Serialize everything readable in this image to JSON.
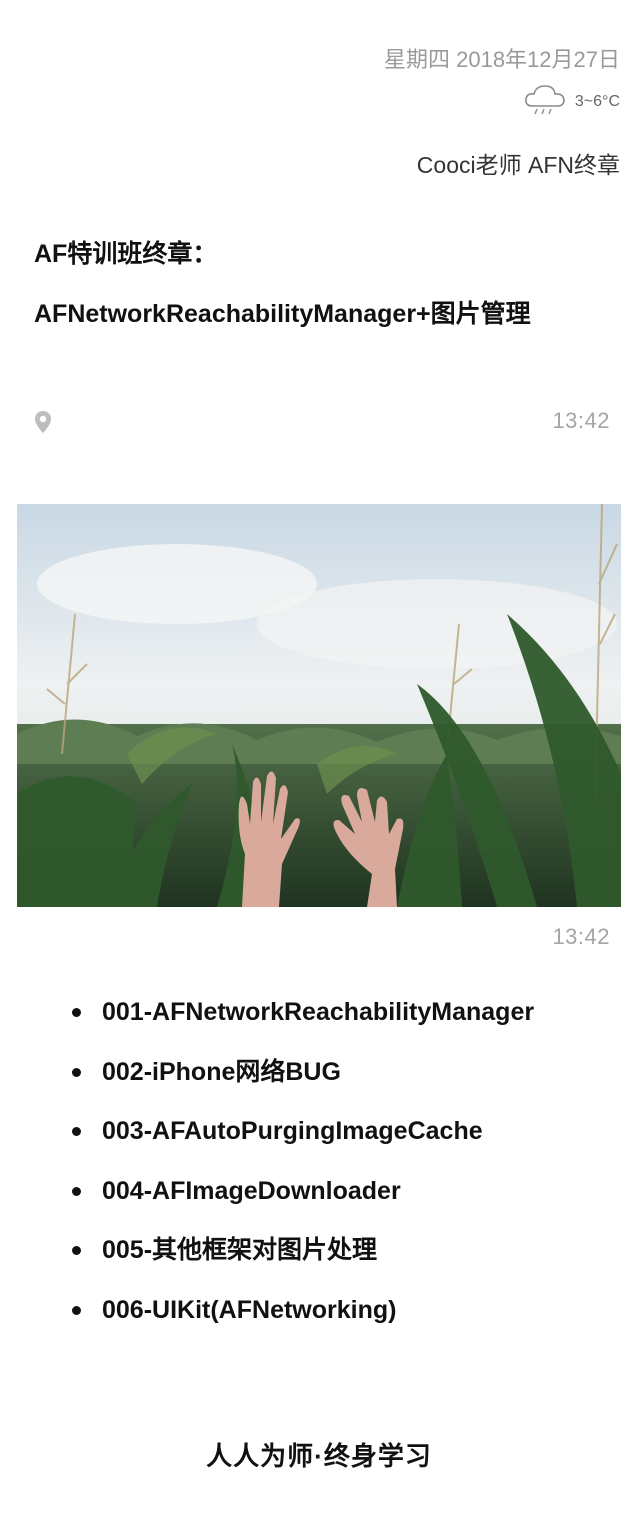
{
  "header": {
    "date": "星期四 2018年12月27日",
    "weather_icon": "rain-cloud-icon",
    "temperature": "3~6°C",
    "author": "Cooci老师 AFN终章"
  },
  "title": {
    "line1": "AF特训班终章：",
    "line2": "AFNetworkReachabilityManager+图片管理"
  },
  "meta_row": {
    "location_icon": "location-pin-icon",
    "time": "13:42"
  },
  "photo": {
    "description_icon": "corn-field-hands-photo"
  },
  "photo_time": "13:42",
  "items": [
    "001-AFNetworkReachabilityManager",
    "002-iPhone网络BUG",
    "003-AFAutoPurgingImageCache",
    "004-AFImageDownloader",
    "005-其他框架对图片处理",
    "006-UIKit(AFNetworking)"
  ],
  "footer": "人人为师·终身学习",
  "colors": {
    "muted_text": "#9a9a9a",
    "body_text": "#111111",
    "background": "#ffffff"
  }
}
